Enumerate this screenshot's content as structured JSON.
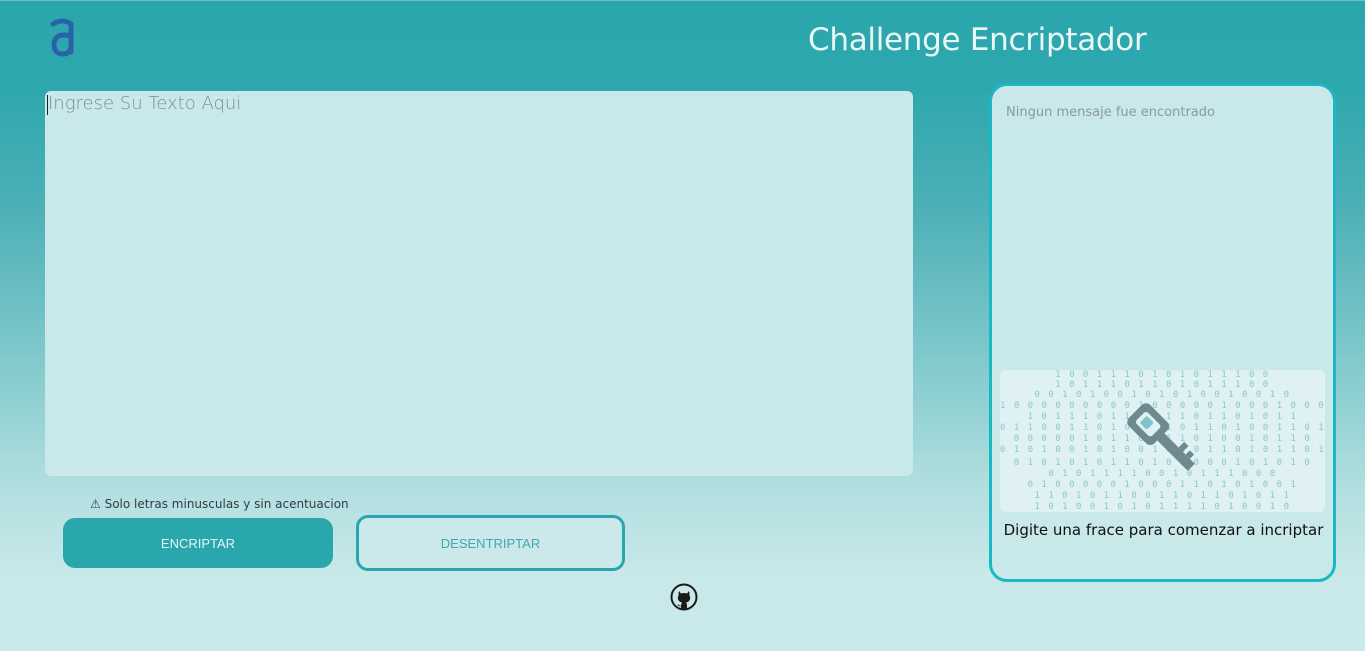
{
  "header": {
    "logo_icon": "alura-logo-icon",
    "title": "Challenge Encriptador"
  },
  "input": {
    "placeholder": "Ingrese Su Texto Aqui",
    "value": ""
  },
  "warning": {
    "icon": "warning-icon",
    "text": "⚠ Solo letras minusculas y sin acentuacion"
  },
  "buttons": {
    "encrypt_label": "ENCRIPTAR",
    "decrypt_label": "DESENTRIPTAR"
  },
  "footer": {
    "github_icon": "github-icon"
  },
  "output_panel": {
    "message": "Ningun mensaje fue encontrado",
    "hint": "Digite una frace para comenzar a incriptar",
    "illustration": "key-binary-illustration"
  },
  "colors": {
    "accent": "#2aa6ad",
    "panel_border": "#19b8c4",
    "panel_bg": "#c9e8e9",
    "title": "#e9f7f7"
  }
}
